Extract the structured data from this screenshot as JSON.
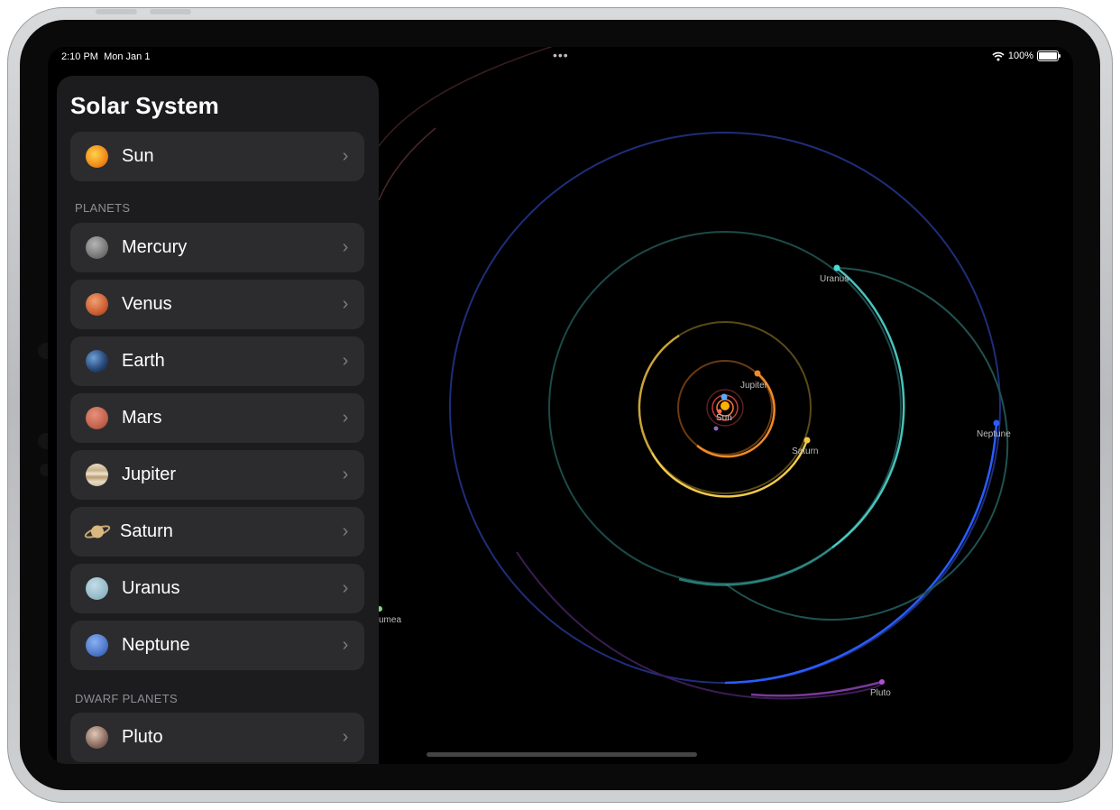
{
  "status": {
    "time": "2:10 PM",
    "date": "Mon Jan 1",
    "battery": "100%"
  },
  "sidebar": {
    "title": "Solar System",
    "sun": {
      "label": "Sun",
      "icon": "sun-icon"
    },
    "planets_header": "PLANETS",
    "planets": [
      {
        "label": "Mercury",
        "icon": "mercury-icon",
        "color": "#8a8a8a"
      },
      {
        "label": "Venus",
        "icon": "venus-icon",
        "color": "#d0683a"
      },
      {
        "label": "Earth",
        "icon": "earth-icon",
        "color": "#2f4b73"
      },
      {
        "label": "Mars",
        "icon": "mars-icon",
        "color": "#c96c55"
      },
      {
        "label": "Jupiter",
        "icon": "jupiter-icon",
        "color": "#d9c8aa"
      },
      {
        "label": "Saturn",
        "icon": "saturn-icon",
        "color": "#c9a66f"
      },
      {
        "label": "Uranus",
        "icon": "uranus-icon",
        "color": "#9fc1cf"
      },
      {
        "label": "Neptune",
        "icon": "neptune-icon",
        "color": "#4e7ad0"
      }
    ],
    "dwarf_header": "DWARF PLANETS",
    "dwarf_planets": [
      {
        "label": "Pluto",
        "icon": "pluto-icon",
        "color": "#8a6a5e"
      }
    ]
  },
  "orbit_labels": {
    "sun": "Sun",
    "jupiter": "Jupiter",
    "saturn": "Saturn",
    "uranus": "Uranus",
    "neptune": "Neptune",
    "pluto": "Pluto",
    "haumea_partial": "umea"
  },
  "colors": {
    "jupiter": "#f08a24",
    "saturn": "#f2c94c",
    "uranus": "#4fd8d2",
    "neptune": "#2a5cff",
    "pluto": "#b04fd0",
    "haumea": "#7ed67e"
  }
}
